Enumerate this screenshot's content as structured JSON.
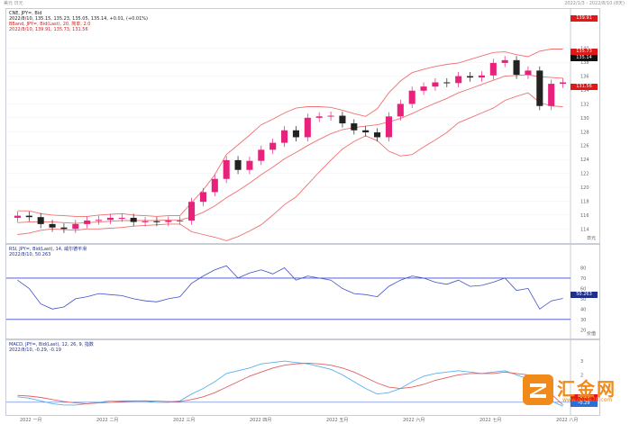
{
  "window": {
    "symbol_cn": "美元 日元",
    "range": "2022/1/3 - 2022/8/10 (8天)"
  },
  "price_panel": {
    "line1": "CNE, JPY=, Bid",
    "line2": "2022/8/10, 135.15, 135.23, 135.05, 135.14, +0.01, (+0.01%)",
    "line3": "BBand, JPY=, Bid(Last), 20, 简单, 2.0",
    "line4": "2022/8/10, 139.91, 135.73, 131.56",
    "tags": {
      "upper": "139.91",
      "mid": "135.73",
      "last": "135.14",
      "lower": "131.56"
    },
    "y_ticks": [
      "140",
      "138",
      "136",
      "134",
      "132",
      "130",
      "128",
      "126",
      "124",
      "122",
      "120",
      "118",
      "116",
      "114"
    ],
    "unit": "日元"
  },
  "rsi_panel": {
    "line1": "RSI, JPY=, Bid(Last), 14, 威尔德平滑",
    "line2": "2022/8/10, 50.263",
    "tag": "50.263",
    "y_ticks": [
      "80",
      "70",
      "60",
      "50",
      "40",
      "30",
      "20"
    ],
    "unit": "价值"
  },
  "macd_panel": {
    "line1": "MACD, JPY=, Bid(Last), 12, 26, 9, 指数",
    "line2": "2022/8/10, -0.29, -0.19",
    "tags": {
      "a": "-0.19",
      "b": "-0.29"
    },
    "y_ticks": [
      "3",
      "2",
      "1",
      "0"
    ],
    "unit": "价值"
  },
  "x_axis": {
    "labels": [
      "2022 一月",
      "2022 二月",
      "2022 三月",
      "2022 四月",
      "2022 五月",
      "2022 六月",
      "2022 七月",
      "2022 八月"
    ]
  },
  "logo": {
    "brand": "汇金网",
    "url": "www.gold678.com"
  },
  "colors": {
    "up": "#e8217a",
    "down": "#222222",
    "bband": "#f07070",
    "rsi": "#4050c8",
    "rsi_level": "#3c4cc8",
    "macd": "#5ab0f0",
    "signal": "#e06060",
    "tag_red": "#e01818",
    "tag_navy": "#20308a",
    "logo_orange": "#f08a1a"
  },
  "chart_data": [
    {
      "type": "candlestick",
      "title": "CNE, JPY=, Bid",
      "x": [
        "2022-01-03",
        "2022-01-07",
        "2022-01-12",
        "2022-01-17",
        "2022-01-21",
        "2022-01-26",
        "2022-01-31",
        "2022-02-04",
        "2022-02-09",
        "2022-02-14",
        "2022-02-18",
        "2022-02-23",
        "2022-02-28",
        "2022-03-04",
        "2022-03-09",
        "2022-03-14",
        "2022-03-18",
        "2022-03-23",
        "2022-03-28",
        "2022-04-01",
        "2022-04-06",
        "2022-04-11",
        "2022-04-15",
        "2022-04-20",
        "2022-04-25",
        "2022-04-29",
        "2022-05-04",
        "2022-05-09",
        "2022-05-13",
        "2022-05-18",
        "2022-05-23",
        "2022-05-27",
        "2022-06-01",
        "2022-06-06",
        "2022-06-10",
        "2022-06-15",
        "2022-06-20",
        "2022-06-24",
        "2022-06-29",
        "2022-07-04",
        "2022-07-08",
        "2022-07-13",
        "2022-07-18",
        "2022-07-22",
        "2022-07-27",
        "2022-08-01",
        "2022-08-05",
        "2022-08-10"
      ],
      "close": [
        115.9,
        115.7,
        114.7,
        114.2,
        114.0,
        114.7,
        115.2,
        115.3,
        115.6,
        115.6,
        115.0,
        115.1,
        115.0,
        115.2,
        115.2,
        117.9,
        119.3,
        121.2,
        123.9,
        122.5,
        123.8,
        125.4,
        126.4,
        128.2,
        127.2,
        130.0,
        130.2,
        130.3,
        129.2,
        128.2,
        127.9,
        127.2,
        130.2,
        132.0,
        133.9,
        134.5,
        135.1,
        135.0,
        136.0,
        135.8,
        136.1,
        137.9,
        138.3,
        136.2,
        136.8,
        131.7,
        134.9,
        135.1
      ],
      "upper_band": [
        116.6,
        116.6,
        116.2,
        116.0,
        115.9,
        115.8,
        115.8,
        116.0,
        116.1,
        116.2,
        116.0,
        115.9,
        115.8,
        115.9,
        115.9,
        117.8,
        119.6,
        121.8,
        124.7,
        126.1,
        127.5,
        129.0,
        129.8,
        130.7,
        131.4,
        131.6,
        131.6,
        131.5,
        131.1,
        130.6,
        130.2,
        131.3,
        133.6,
        135.3,
        136.5,
        137.0,
        137.4,
        137.7,
        137.9,
        138.4,
        138.9,
        139.4,
        139.5,
        139.1,
        138.8,
        139.6,
        139.9,
        139.9
      ],
      "middle_band": [
        114.9,
        115.0,
        115.0,
        115.0,
        114.9,
        114.8,
        114.9,
        115.0,
        115.1,
        115.2,
        115.2,
        115.2,
        115.2,
        115.3,
        115.3,
        115.7,
        116.4,
        117.3,
        118.5,
        119.5,
        120.6,
        121.8,
        122.9,
        124.1,
        125.0,
        126.0,
        126.9,
        127.7,
        128.3,
        128.6,
        128.8,
        129.0,
        129.4,
        129.9,
        130.6,
        131.4,
        132.1,
        132.8,
        133.6,
        134.2,
        134.8,
        135.4,
        136.0,
        136.1,
        136.2,
        135.9,
        135.8,
        135.7
      ],
      "lower_band": [
        113.2,
        113.4,
        113.8,
        114.0,
        113.9,
        113.8,
        114.0,
        114.0,
        114.1,
        114.2,
        114.4,
        114.5,
        114.6,
        114.7,
        114.7,
        113.6,
        113.2,
        112.8,
        112.3,
        112.9,
        113.7,
        114.6,
        116.0,
        117.5,
        118.6,
        120.4,
        122.2,
        123.9,
        125.5,
        126.6,
        127.4,
        126.7,
        125.2,
        124.5,
        124.7,
        125.8,
        126.8,
        127.9,
        129.3,
        130.0,
        130.7,
        131.4,
        132.5,
        133.1,
        133.6,
        132.2,
        131.7,
        131.6
      ],
      "ylim": [
        113,
        141
      ]
    },
    {
      "type": "line",
      "title": "RSI, JPY=, Bid(Last), 14, 威尔德平滑",
      "series": [
        {
          "name": "RSI",
          "values": [
            68,
            60,
            45,
            40,
            42,
            50,
            52,
            55,
            54,
            53,
            50,
            48,
            47,
            50,
            52,
            65,
            72,
            78,
            82,
            70,
            75,
            78,
            74,
            80,
            68,
            72,
            70,
            68,
            60,
            55,
            54,
            52,
            62,
            68,
            72,
            70,
            66,
            64,
            68,
            62,
            63,
            66,
            70,
            58,
            60,
            40,
            48,
            50.3
          ]
        }
      ],
      "levels": [
        70,
        30
      ],
      "ylim": [
        15,
        90
      ]
    },
    {
      "type": "line",
      "title": "MACD, JPY=, Bid(Last), 12, 26, 9, 指数",
      "series": [
        {
          "name": "MACD",
          "values": [
            0.4,
            0.3,
            0.1,
            -0.1,
            -0.2,
            -0.2,
            -0.1,
            0.0,
            0.1,
            0.1,
            0.1,
            0.1,
            0.0,
            0.0,
            0.1,
            0.6,
            1.0,
            1.5,
            2.1,
            2.3,
            2.5,
            2.8,
            2.9,
            3.0,
            2.9,
            2.8,
            2.6,
            2.4,
            2.0,
            1.5,
            1.0,
            0.6,
            0.7,
            1.0,
            1.5,
            1.9,
            2.1,
            2.2,
            2.3,
            2.2,
            2.1,
            2.2,
            2.3,
            2.0,
            1.7,
            0.7,
            0.1,
            -0.29
          ]
        },
        {
          "name": "Signal",
          "values": [
            0.5,
            0.45,
            0.35,
            0.2,
            0.05,
            -0.05,
            -0.1,
            -0.05,
            0.0,
            0.05,
            0.08,
            0.1,
            0.08,
            0.05,
            0.05,
            0.2,
            0.4,
            0.7,
            1.1,
            1.5,
            1.9,
            2.2,
            2.5,
            2.7,
            2.8,
            2.85,
            2.8,
            2.7,
            2.5,
            2.2,
            1.8,
            1.4,
            1.1,
            1.0,
            1.1,
            1.3,
            1.6,
            1.8,
            2.0,
            2.1,
            2.1,
            2.1,
            2.2,
            2.1,
            2.0,
            1.5,
            0.6,
            -0.19
          ]
        }
      ],
      "ylim": [
        -0.6,
        3.6
      ]
    }
  ]
}
